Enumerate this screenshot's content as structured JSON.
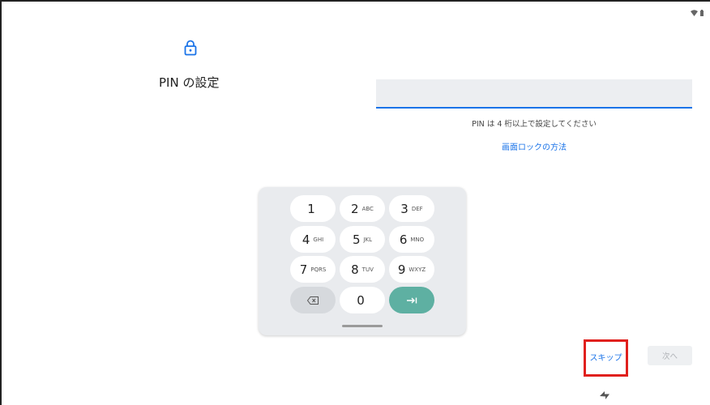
{
  "status_bar": {
    "icons": [
      "wifi-icon",
      "battery-icon"
    ]
  },
  "header": {
    "title": "PIN の設定",
    "icon": "lock-icon"
  },
  "pin_input": {
    "value": "",
    "hint": "PIN は 4 桁以上で設定してください"
  },
  "help_link": "画面ロックの方法",
  "keypad": {
    "keys": [
      {
        "digit": "1",
        "letters": ""
      },
      {
        "digit": "2",
        "letters": "ABC"
      },
      {
        "digit": "3",
        "letters": "DEF"
      },
      {
        "digit": "4",
        "letters": "GHI"
      },
      {
        "digit": "5",
        "letters": "JKL"
      },
      {
        "digit": "6",
        "letters": "MNO"
      },
      {
        "digit": "7",
        "letters": "PQRS"
      },
      {
        "digit": "8",
        "letters": "TUV"
      },
      {
        "digit": "9",
        "letters": "WXYZ"
      },
      {
        "digit": "0",
        "letters": ""
      }
    ],
    "delete_icon": "backspace-icon",
    "enter_icon": "tab-arrow-icon"
  },
  "footer": {
    "skip_label": "スキップ",
    "next_label": "次へ"
  },
  "colors": {
    "accent": "#1a73e8",
    "enter_key": "#5eb0a2",
    "highlight": "#e0201d"
  }
}
